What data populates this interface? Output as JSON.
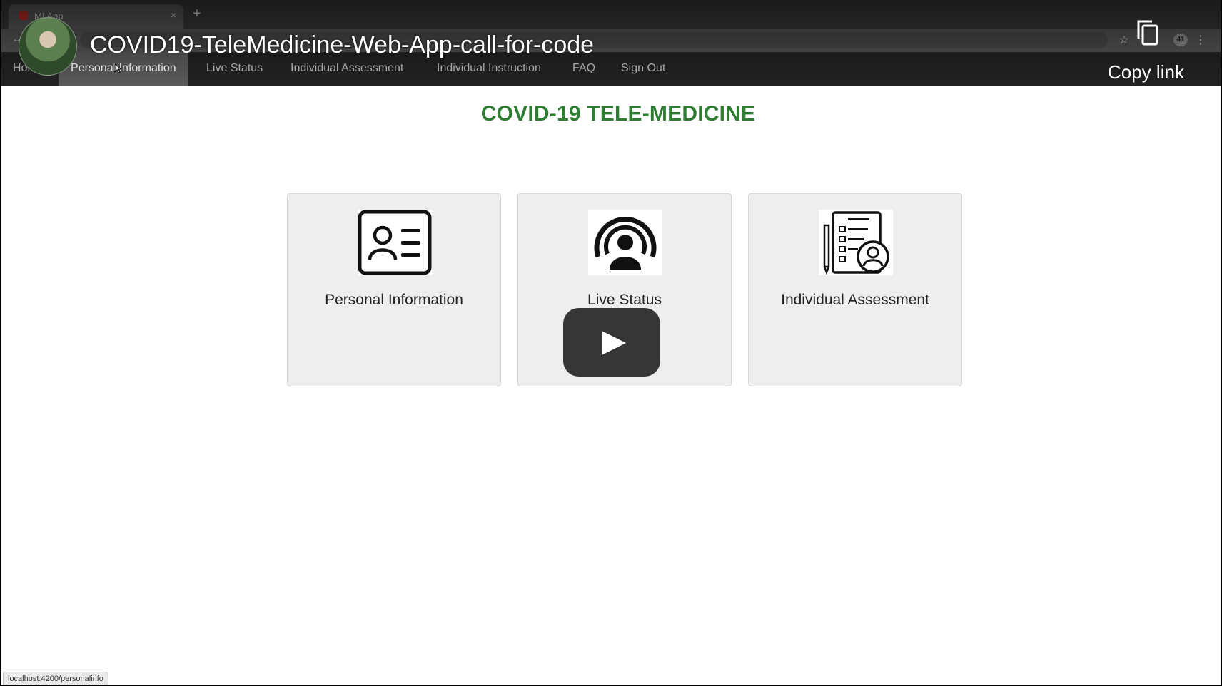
{
  "browser": {
    "tab_title": "MI App",
    "tab_close": "×",
    "new_tab": "+",
    "back": "←",
    "star": "☆",
    "ext_badge": "41",
    "menu": "⋮"
  },
  "navbar": {
    "items": [
      {
        "label": "Hom",
        "active": false
      },
      {
        "label": "Personal Information",
        "active": true
      },
      {
        "label": "Live Status",
        "active": false
      },
      {
        "label": "Individual Assessment",
        "active": false
      },
      {
        "label": "Individual Instruction",
        "active": false
      },
      {
        "label": "FAQ",
        "active": false
      },
      {
        "label": "Sign Out",
        "active": false
      }
    ]
  },
  "main": {
    "title": "COVID-19 TELE-MEDICINE",
    "cards": [
      {
        "label": "Personal Information",
        "icon": "id-card-icon"
      },
      {
        "label": "Live Status",
        "icon": "broadcast-person-icon"
      },
      {
        "label": "Individual Assessment",
        "icon": "checklist-person-icon"
      }
    ]
  },
  "statusbar": {
    "url": "localhost:4200/personalinfo"
  },
  "video_overlay": {
    "title": "COVID19-TeleMedicine-Web-App-call-for-code",
    "copy_link": "Copy link",
    "play_icon": "play-icon"
  },
  "colors": {
    "title_green": "#2e7d32",
    "navbar_bg": "#222222",
    "nav_active_bg": "#5a5a5a",
    "card_bg": "#eeeeee"
  }
}
